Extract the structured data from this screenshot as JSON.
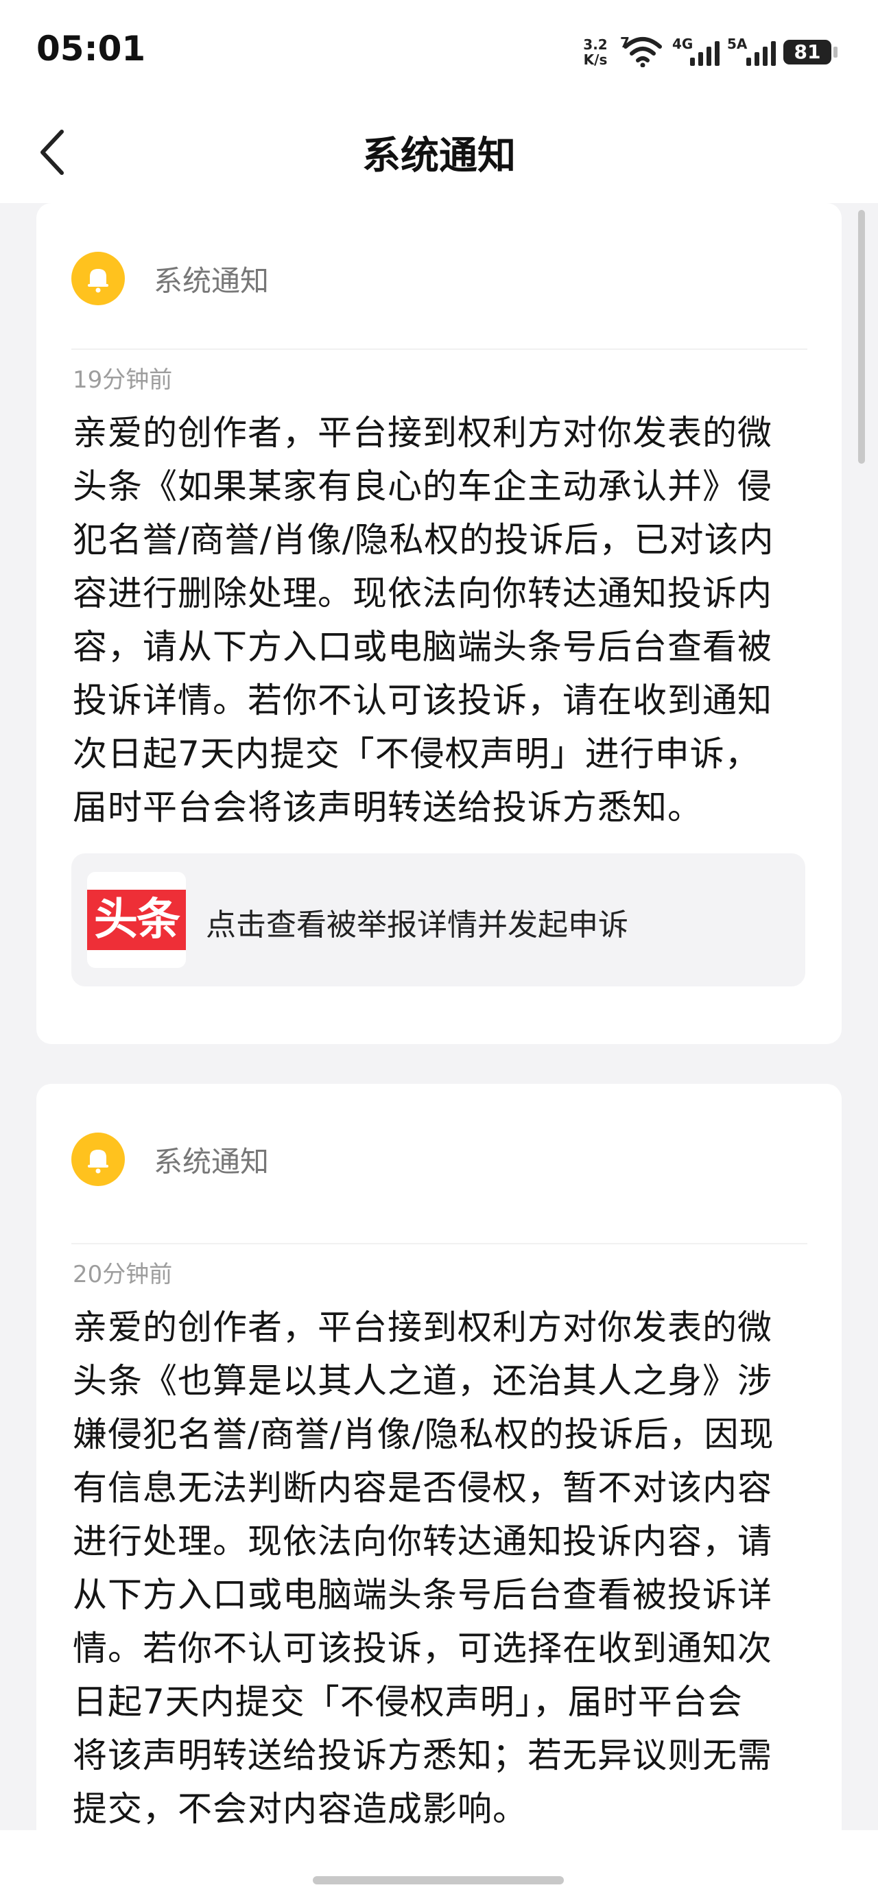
{
  "status_bar": {
    "time": "05:01",
    "net_speed_value": "3.2",
    "net_speed_unit": "K/s",
    "wifi_label": "7",
    "sim1_label": "4G",
    "sim2_label": "5A",
    "battery": "81"
  },
  "header": {
    "title": "系统通知"
  },
  "notifications": [
    {
      "sender": "系统通知",
      "time_ago": "19分钟前",
      "lines": [
        "亲爱的创作者，平台接到权利方对你发表的微",
        "头条《如果某家有良心的车企主动承认并》侵",
        "犯名誉/商誉/肖像/隐私权的投诉后，已对该内",
        "容进行删除处理。现依法向你转达通知投诉内",
        "容，请从下方入口或电脑端头条号后台查看被",
        "投诉详情。若你不认可该投诉，请在收到通知",
        "次日起7天内提交「不侵权声明」进行申诉，",
        "届时平台会将该声明转送给投诉方悉知。"
      ],
      "link_logo_text": "头条",
      "link_text": "点击查看被举报详情并发起申诉"
    },
    {
      "sender": "系统通知",
      "time_ago": "20分钟前",
      "lines": [
        "亲爱的创作者，平台接到权利方对你发表的微",
        "头条《也算是以其人之道，还治其人之身》涉",
        "嫌侵犯名誉/商誉/肖像/隐私权的投诉后，因现",
        "有信息无法判断内容是否侵权，暂不对该内容",
        "进行处理。现依法向你转达通知投诉内容，请",
        "从下方入口或电脑端头条号后台查看被投诉详",
        "情。若你不认可该投诉，可选择在收到通知次",
        "日起7天内提交「不侵权声明」，届时平台会",
        "将该声明转送给投诉方悉知；若无异议则无需",
        "提交，不会对内容造成影响。"
      ]
    }
  ],
  "colors": {
    "bell": "#ffc21e",
    "logo_red": "#ee2f37",
    "page_bg": "#f3f3f5"
  }
}
